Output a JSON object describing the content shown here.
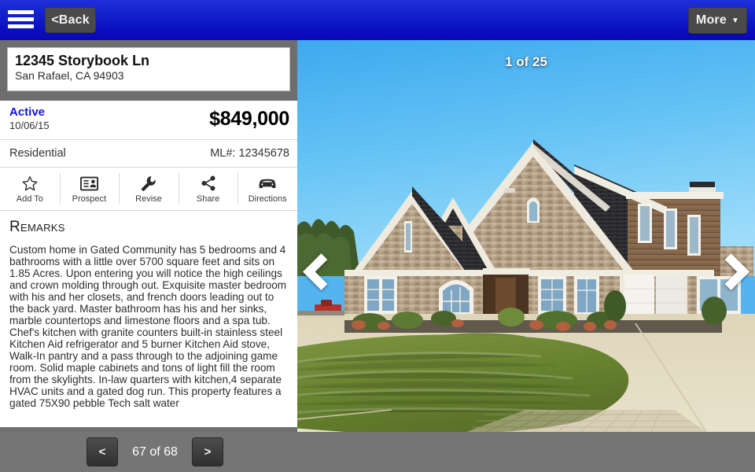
{
  "topbar": {
    "menu_icon": "hamburger-menu-icon",
    "back_label": "<Back",
    "more_label": "More",
    "more_caret": "▼",
    "gradient_top": "#1f2ed6",
    "gradient_bottom": "#0808b4"
  },
  "listing": {
    "address_line1": "12345 Storybook Ln",
    "address_line2": "San Rafael, CA 94903",
    "status": "Active",
    "status_color": "#1414e0",
    "status_date": "10/06/15",
    "price": "$849,000",
    "property_type": "Residential",
    "ml_number": "ML#: 12345678"
  },
  "actions": [
    {
      "label": "Add To",
      "icon": "star-icon"
    },
    {
      "label": "Prospect",
      "icon": "contact-card-icon"
    },
    {
      "label": "Revise",
      "icon": "wrench-icon"
    },
    {
      "label": "Share",
      "icon": "share-nodes-icon"
    },
    {
      "label": "Directions",
      "icon": "car-icon"
    }
  ],
  "remarks": {
    "title": "Remarks",
    "body": "Custom home in Gated Community has 5 bedrooms and 4 bathrooms with a little over 5700 square feet and sits on 1.85 Acres. Upon entering you will notice the high ceilings and crown molding through out. Exquisite master bedroom with his and her closets, and french doors leading out to the back yard. Master bathroom has his and her sinks, marble countertops and limestone floors and a spa tub. Chef's kitchen with granite counters built-in stainless steel Kitchen Aid refrigerator and 5 burner Kitchen Aid stove, Walk-In pantry and a pass through to the adjoining game room. Solid maple cabinets and tons of light fill the room from the skylights. In-law quarters with kitchen,4 separate HVAC units and a gated dog run. This property features a gated 75X90 pebble Tech salt water"
  },
  "photo": {
    "counter": "1 of 25",
    "prev_icon": "chevron-left-icon",
    "next_icon": "chevron-right-icon",
    "alt": "Exterior front view of large brick and stone two-story house with circular driveway and green lawn under clear blue sky",
    "sky_color": "#5cbcf2",
    "lawn_color": "#6f8a35",
    "driveway_color": "#e4dcc2"
  },
  "pager": {
    "prev_label": "<",
    "next_label": ">",
    "position_label": "67 of 68"
  }
}
